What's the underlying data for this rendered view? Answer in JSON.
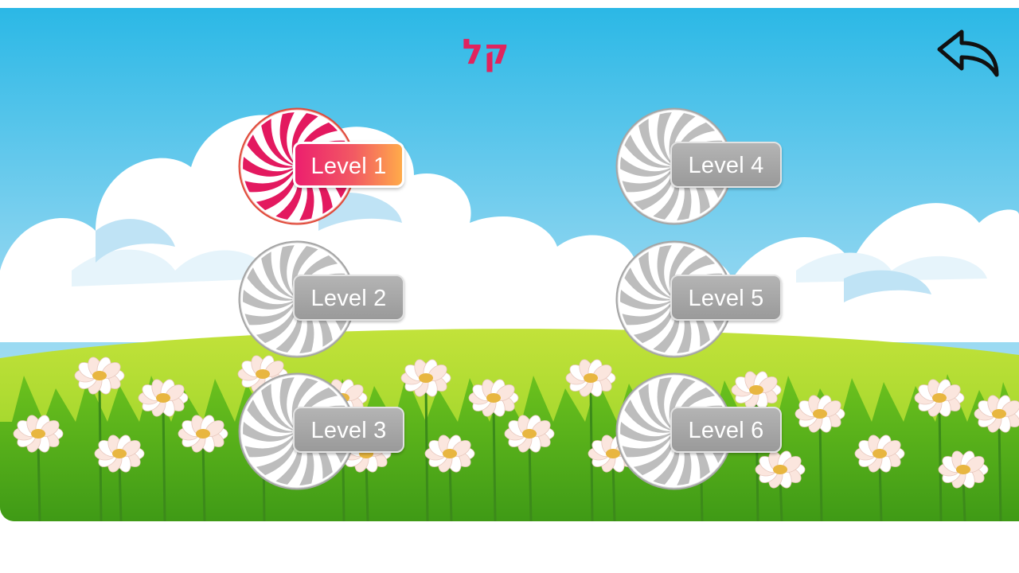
{
  "title": "קל",
  "levels": [
    {
      "label": "Level 1",
      "state": "active"
    },
    {
      "label": "Level 2",
      "state": "locked"
    },
    {
      "label": "Level 3",
      "state": "locked"
    },
    {
      "label": "Level 4",
      "state": "locked"
    },
    {
      "label": "Level 5",
      "state": "locked"
    },
    {
      "label": "Level 6",
      "state": "locked"
    }
  ],
  "icons": {
    "back": "back-arrow-icon",
    "level_badge": "swirl-candy-icon"
  },
  "colors": {
    "title": "#e0245e",
    "sky_top": "#2bb8e6",
    "grass": "#9fd82a",
    "active_candy": "#e3195f",
    "locked_candy": "#bdbdbd",
    "active_pill_start": "#ec1f6e",
    "active_pill_end": "#ffab4a",
    "locked_pill": "#a8a8a8"
  }
}
